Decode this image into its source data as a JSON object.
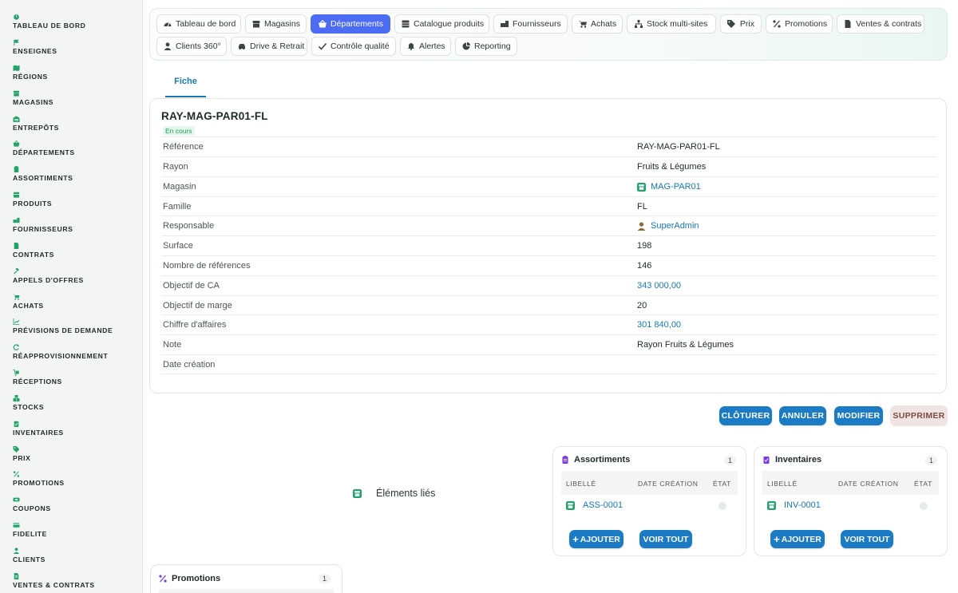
{
  "colors": {
    "accent_green": "#23a36b",
    "active_tab": "#4d6cf4",
    "primary_button": "#1b7bc4",
    "link": "#1679b3",
    "badge_green": "#1f9d55",
    "purple_icon": "#7c3aed"
  },
  "sidebar": {
    "items": [
      {
        "label": "TABLEAU DE BORD",
        "icon": "dashboard-icon"
      },
      {
        "label": "ENSEIGNES",
        "icon": "flag-icon"
      },
      {
        "label": "RÉGIONS",
        "icon": "map-icon"
      },
      {
        "label": "MAGASINS",
        "icon": "store-icon"
      },
      {
        "label": "ENTREPÔTS",
        "icon": "warehouse-icon"
      },
      {
        "label": "DÉPARTEMENTS",
        "icon": "basket-icon"
      },
      {
        "label": "ASSORTIMENTS",
        "icon": "clipboard-icon"
      },
      {
        "label": "PRODUITS",
        "icon": "box-icon"
      },
      {
        "label": "FOURNISSEURS",
        "icon": "supplier-icon"
      },
      {
        "label": "CONTRATS",
        "icon": "document-icon"
      },
      {
        "label": "APPELS D'OFFRES",
        "icon": "gavel-icon"
      },
      {
        "label": "ACHATS",
        "icon": "cart-icon"
      },
      {
        "label": "PRÉVISIONS DE DEMANDE",
        "icon": "chart-icon"
      },
      {
        "label": "RÉAPPROVISIONNEMENT",
        "icon": "refresh-icon"
      },
      {
        "label": "RÉCEPTIONS",
        "icon": "dolly-icon"
      },
      {
        "label": "STOCKS",
        "icon": "boxes-icon"
      },
      {
        "label": "INVENTAIRES",
        "icon": "checklist-icon"
      },
      {
        "label": "PRIX",
        "icon": "tag-icon"
      },
      {
        "label": "PROMOTIONS",
        "icon": "percent-icon"
      },
      {
        "label": "COUPONS",
        "icon": "ticket-icon"
      },
      {
        "label": "FIDELITE",
        "icon": "card-icon"
      },
      {
        "label": "CLIENTS",
        "icon": "user-icon"
      },
      {
        "label": "VENTES & CONTRATS",
        "icon": "document-icon"
      }
    ]
  },
  "topnav": {
    "tabs": [
      {
        "label": "Tableau de bord",
        "icon": "gauge-icon"
      },
      {
        "label": "Magasins",
        "icon": "store-icon"
      },
      {
        "label": "Départements",
        "icon": "basket-icon"
      },
      {
        "label": "Catalogue produits",
        "icon": "table-icon"
      },
      {
        "label": "Fournisseurs",
        "icon": "supplier-icon"
      },
      {
        "label": "Achats",
        "icon": "cart-icon"
      },
      {
        "label": "Stock multi-sites",
        "icon": "network-icon"
      },
      {
        "label": "Prix",
        "icon": "tag-icon"
      },
      {
        "label": "Promotions",
        "icon": "percent-icon"
      },
      {
        "label": "Ventes & contrats",
        "icon": "document-icon"
      },
      {
        "label": "Clients 360°",
        "icon": "user-icon"
      },
      {
        "label": "Drive & Retrait",
        "icon": "car-icon"
      },
      {
        "label": "Contrôle qualité",
        "icon": "check-icon"
      },
      {
        "label": "Alertes",
        "icon": "bell-icon"
      },
      {
        "label": "Reporting",
        "icon": "pie-icon"
      }
    ],
    "active": "Départements"
  },
  "subtabs": {
    "fiche": "Fiche"
  },
  "record": {
    "title": "RAY-MAG-PAR01-FL",
    "status": "En cours",
    "fields": [
      {
        "label": "Référence",
        "value": "RAY-MAG-PAR01-FL",
        "type": "text"
      },
      {
        "label": "Rayon",
        "value": "Fruits & Légumes",
        "type": "text"
      },
      {
        "label": "Magasin",
        "value": "MAG-PAR01",
        "type": "link",
        "icon": "store-icon"
      },
      {
        "label": "Famille",
        "value": "FL",
        "type": "text"
      },
      {
        "label": "Responsable",
        "value": "SuperAdmin",
        "type": "link",
        "icon": "user-icon"
      },
      {
        "label": "Surface",
        "value": "198",
        "type": "text"
      },
      {
        "label": "Nombre de références",
        "value": "146",
        "type": "text"
      },
      {
        "label": "Objectif de CA",
        "value": "343 000,00",
        "type": "link"
      },
      {
        "label": "Objectif de marge",
        "value": "20",
        "type": "text"
      },
      {
        "label": "Chiffre d'affaires",
        "value": "301 840,00",
        "type": "link"
      },
      {
        "label": "Note",
        "value": "Rayon Fruits & Légumes",
        "type": "text"
      },
      {
        "label": "Date création",
        "value": "",
        "type": "text"
      }
    ]
  },
  "actions": {
    "close": "CLÔTURER",
    "cancel": "ANNULER",
    "edit": "MODIFIER",
    "delete": "SUPPRIMER"
  },
  "related": {
    "label": "Éléments liés",
    "panels": [
      {
        "title": "Assortiments",
        "icon": "clipboard-icon",
        "count": "1",
        "columns": [
          "LIBELLÉ",
          "DATE CRÉATION",
          "ÉTAT"
        ],
        "rows": [
          {
            "label": "ASS-0001"
          }
        ],
        "add": "AJOUTER",
        "view_all": "VOIR TOUT"
      },
      {
        "title": "Inventaires",
        "icon": "checklist-icon",
        "count": "1",
        "columns": [
          "LIBELLÉ",
          "DATE CRÉATION",
          "ÉTAT"
        ],
        "rows": [
          {
            "label": "INV-0001"
          }
        ],
        "add": "AJOUTER",
        "view_all": "VOIR TOUT"
      }
    ],
    "promotions": {
      "title": "Promotions",
      "icon": "percent-icon",
      "count": "1"
    }
  }
}
